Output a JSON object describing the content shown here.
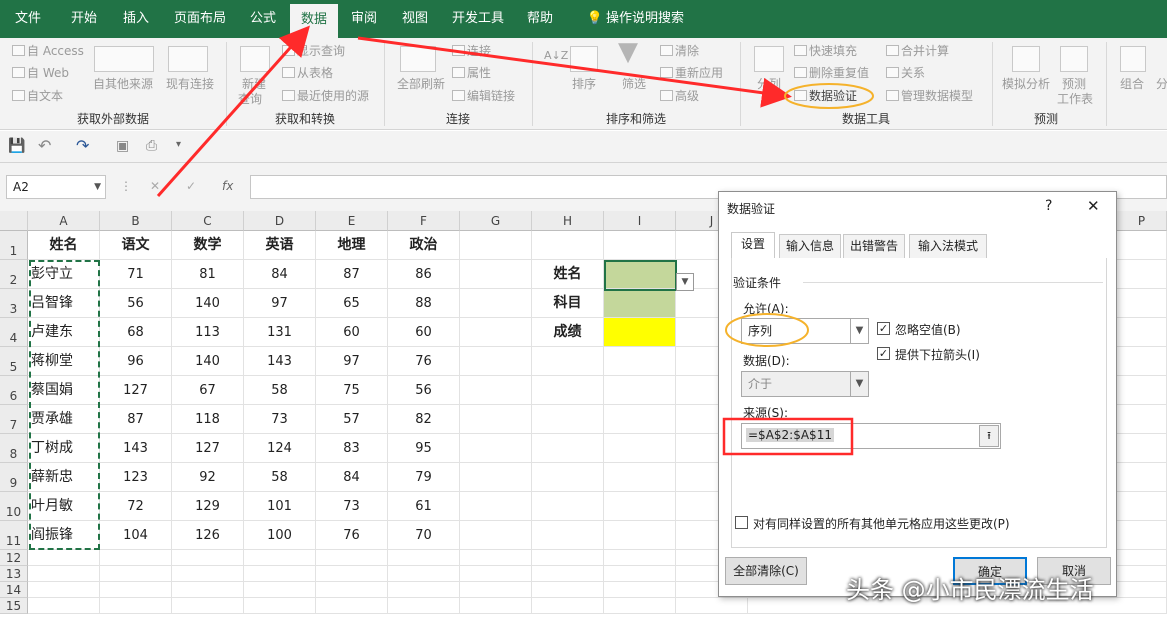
{
  "tabs": [
    "文件",
    "开始",
    "插入",
    "页面布局",
    "公式",
    "数据",
    "审阅",
    "视图",
    "开发工具",
    "帮助",
    "操作说明搜索"
  ],
  "ribbon": {
    "get_external": {
      "access": "自 Access",
      "web": "自 Web",
      "text": "自文本",
      "other": "自其他来源",
      "existing": "现有连接",
      "label": "获取外部数据"
    },
    "transform": {
      "new_query_1": "新建",
      "new_query_2": "查询",
      "show_query": "显示查询",
      "from_table": "从表格",
      "recent": "最近使用的源",
      "label": "获取和转换"
    },
    "connections": {
      "refresh_all": "全部刷新",
      "connections": "连接",
      "properties": "属性",
      "edit_links": "编辑链接",
      "label": "连接"
    },
    "sort_filter": {
      "az": "A↓Z",
      "sort": "排序",
      "filter": "筛选",
      "clear": "清除",
      "reapply": "重新应用",
      "advanced": "高级",
      "label": "排序和筛选"
    },
    "data_tools": {
      "split": "分列",
      "flash_fill": "快速填充",
      "remove_dup": "删除重复值",
      "validation": "数据验证",
      "consolidate": "合并计算",
      "relations": "关系",
      "model": "管理数据模型",
      "label": "数据工具"
    },
    "forecast": {
      "whatif": "模拟分析",
      "sheet_1": "预测",
      "sheet_2": "工作表",
      "label": "预测"
    },
    "outline": {
      "group": "组合",
      "partial": "分"
    }
  },
  "qat": {
    "save": "💾",
    "undo": "↶",
    "redo": "↷",
    "more": "▾"
  },
  "namebox": "A2",
  "fx_buttons": {
    "cancel": "✕",
    "enter": "✓",
    "fx": "fx"
  },
  "columns": [
    "A",
    "B",
    "C",
    "D",
    "E",
    "F",
    "G",
    "H",
    "I",
    "J",
    "P"
  ],
  "rows": [
    "1",
    "2",
    "3",
    "4",
    "5",
    "6",
    "7",
    "8",
    "9",
    "10",
    "11",
    "12",
    "13",
    "14",
    "15"
  ],
  "table": {
    "headers": [
      "姓名",
      "语文",
      "数学",
      "英语",
      "地理",
      "政治"
    ],
    "rows": [
      [
        "彭守立",
        "71",
        "81",
        "84",
        "87",
        "86"
      ],
      [
        "吕智锋",
        "56",
        "140",
        "97",
        "65",
        "88"
      ],
      [
        "卢建东",
        "68",
        "113",
        "131",
        "60",
        "60"
      ],
      [
        "蒋柳堂",
        "96",
        "140",
        "143",
        "97",
        "76"
      ],
      [
        "蔡国娟",
        "127",
        "67",
        "58",
        "75",
        "56"
      ],
      [
        "贾承雄",
        "87",
        "118",
        "73",
        "57",
        "82"
      ],
      [
        "丁树成",
        "143",
        "127",
        "124",
        "83",
        "95"
      ],
      [
        "薛新忠",
        "123",
        "92",
        "58",
        "84",
        "79"
      ],
      [
        "叶月敏",
        "72",
        "129",
        "101",
        "73",
        "61"
      ],
      [
        "阎振锋",
        "104",
        "126",
        "100",
        "76",
        "70"
      ]
    ]
  },
  "side_labels": [
    "姓名",
    "科目",
    "成绩"
  ],
  "colors": {
    "green_fill": "#c4d79b",
    "yellow_fill": "#ffff00",
    "excel_green": "#217346",
    "annot_red": "#ff2a2a",
    "annot_orange": "#f5b22b"
  },
  "dialog": {
    "title": "数据验证",
    "help": "?",
    "close": "✕",
    "tabs": [
      "设置",
      "输入信息",
      "出错警告",
      "输入法模式"
    ],
    "section": "验证条件",
    "allow_label": "允许(A):",
    "allow_value": "序列",
    "ignore_blank": "忽略空值(B)",
    "dropdown": "提供下拉箭头(I)",
    "data_label": "数据(D):",
    "data_value": "介于",
    "source_label": "来源(S):",
    "source_value": "=$A$2:$A$11",
    "apply_all": "对有同样设置的所有其他单元格应用这些更改(P)",
    "clear_all": "全部清除(C)",
    "ok": "确定",
    "cancel": "取消"
  },
  "watermark": "头条 @小市民漂流生活"
}
